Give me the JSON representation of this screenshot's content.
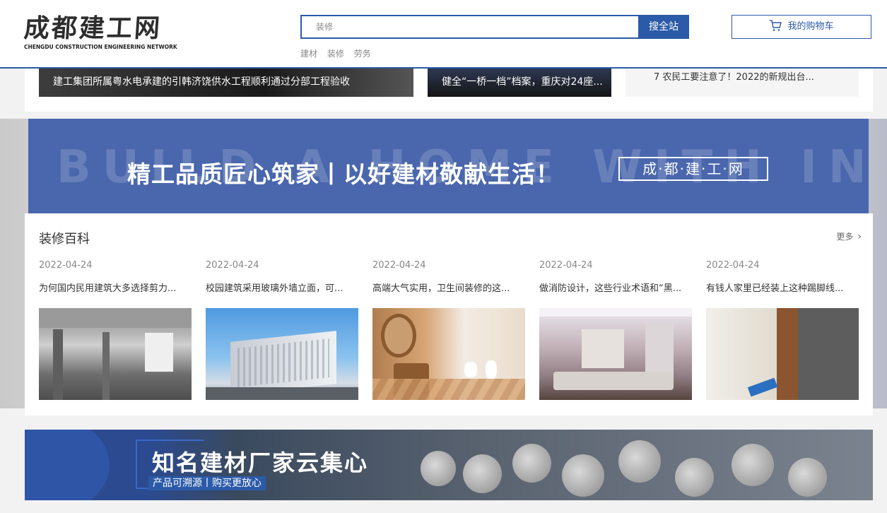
{
  "header": {
    "logo_main": "成都建工网",
    "logo_sub": "CHENGDU CONSTRUCTION ENGINEERING NETWORK",
    "search_value": "装修",
    "search_button": "搜全站",
    "hot_links": [
      "建材",
      "装修",
      "劳务"
    ],
    "cart_label": "我的购物车"
  },
  "top_news": {
    "caption_1": "建工集团所属粤水电承建的引韩济饶供水工程顺利通过分部工程验收",
    "caption_2": "健全“一桥一档”档案，重庆对24座...",
    "list_item": "7   农民工要注意了！2022的新规出台..."
  },
  "banner": {
    "bg_text": "BUILD A HOME WITH INGENUITY",
    "slogan": "精工品质匠心筑家丨以好建材敬献生活！",
    "box_text": "成·都·建·工·网"
  },
  "deco_section": {
    "title": "装修百科",
    "more": "更多",
    "cards": [
      {
        "date": "2022-04-24",
        "title": "为何国内民用建筑大多选择剪力..."
      },
      {
        "date": "2022-04-24",
        "title": "校园建筑采用玻璃外墙立面，可..."
      },
      {
        "date": "2022-04-24",
        "title": "高端大气实用，卫生间装修的这..."
      },
      {
        "date": "2022-04-24",
        "title": "做消防设计，这些行业术语和“黑..."
      },
      {
        "date": "2022-04-24",
        "title": "有钱人家里已经装上这种踢脚线..."
      }
    ]
  },
  "bottom_banner": {
    "title": "知名建材厂家云集心",
    "subtitle": "产品可溯源丨购买更放心"
  },
  "colors": {
    "brand_blue": "#2b5aa8",
    "banner_blue": "#4a67ad"
  }
}
